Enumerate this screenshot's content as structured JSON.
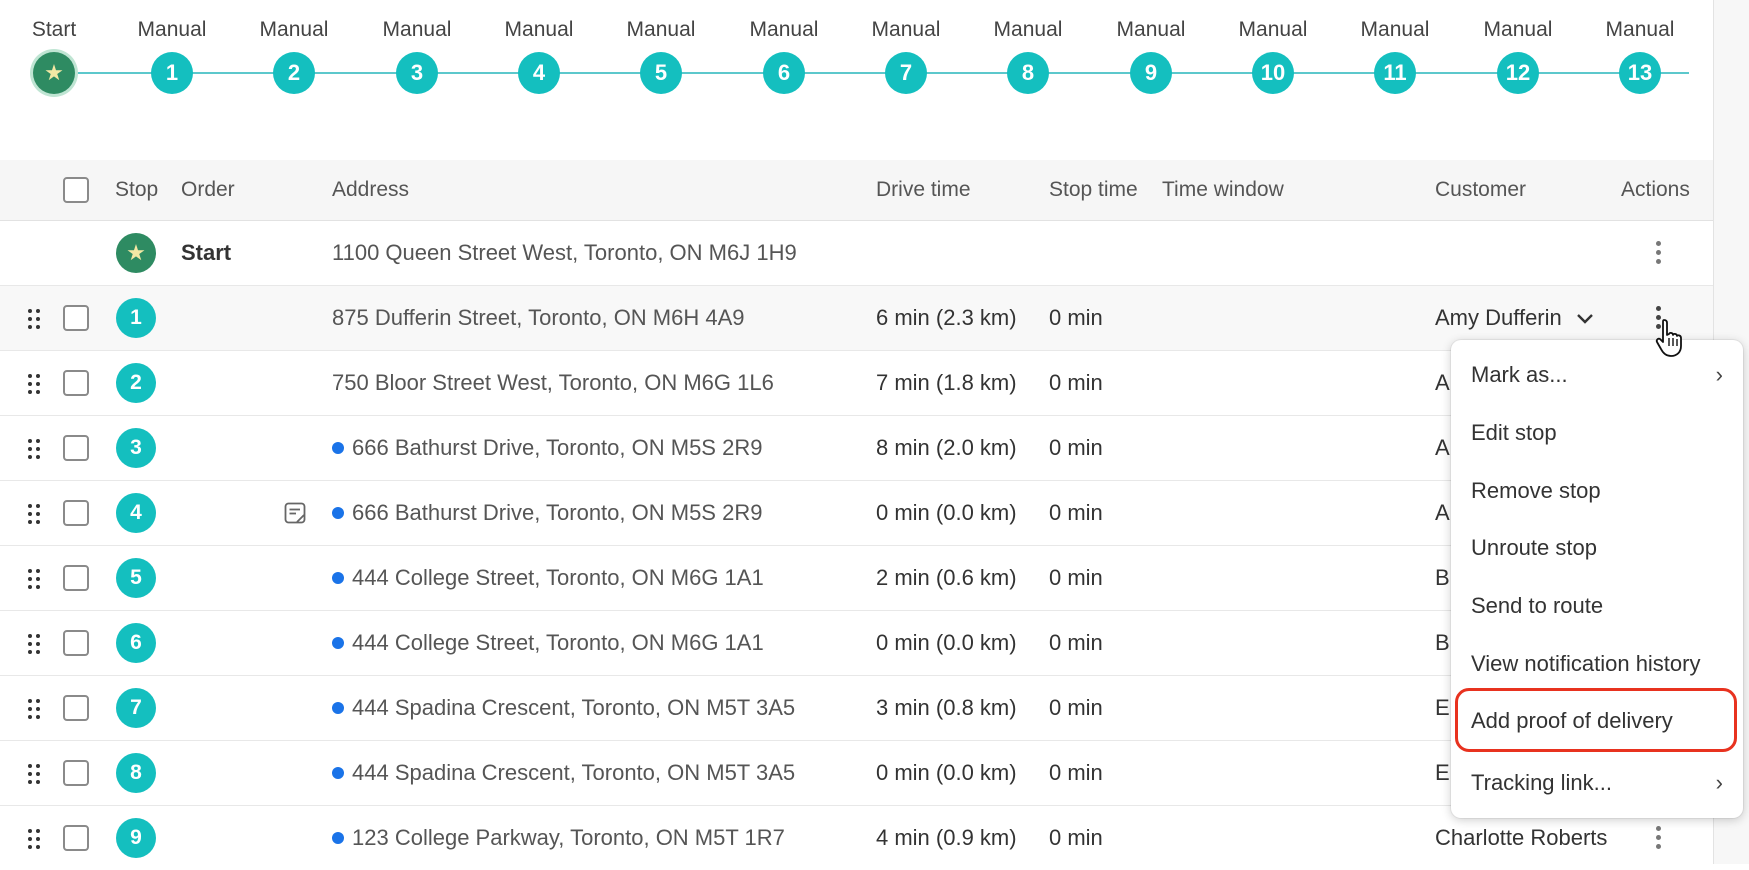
{
  "timeline": {
    "nodes": [
      {
        "label": "Start",
        "badge": "",
        "type": "start"
      },
      {
        "label": "Manual",
        "badge": "1"
      },
      {
        "label": "Manual",
        "badge": "2"
      },
      {
        "label": "Manual",
        "badge": "3"
      },
      {
        "label": "Manual",
        "badge": "4"
      },
      {
        "label": "Manual",
        "badge": "5"
      },
      {
        "label": "Manual",
        "badge": "6"
      },
      {
        "label": "Manual",
        "badge": "7"
      },
      {
        "label": "Manual",
        "badge": "8"
      },
      {
        "label": "Manual",
        "badge": "9"
      },
      {
        "label": "Manual",
        "badge": "10"
      },
      {
        "label": "Manual",
        "badge": "11"
      },
      {
        "label": "Manual",
        "badge": "12"
      },
      {
        "label": "Manual",
        "badge": "13"
      }
    ]
  },
  "table": {
    "headers": {
      "stop": "Stop",
      "order": "Order",
      "address": "Address",
      "drive_time": "Drive time",
      "stop_time": "Stop time",
      "time_window": "Time window",
      "customer": "Customer",
      "actions": "Actions"
    },
    "start_row": {
      "label": "Start",
      "address": "1100 Queen Street West, Toronto, ON M6J 1H9"
    },
    "rows": [
      {
        "stop": "1",
        "address": "875 Dufferin Street, Toronto, ON M6H 4A9",
        "drive": "6 min (2.3 km)",
        "stop_time": "0 min",
        "customer": "Amy Dufferin"
      },
      {
        "stop": "2",
        "address": "750 Bloor Street West, Toronto, ON M6G 1L6",
        "drive": "7 min (1.8 km)",
        "stop_time": "0 min",
        "customer": "A"
      },
      {
        "stop": "3",
        "address": "666 Bathurst Drive, Toronto, ON M5S 2R9",
        "drive": "8 min (2.0 km)",
        "stop_time": "0 min",
        "customer": "A"
      },
      {
        "stop": "4",
        "address": "666 Bathurst Drive, Toronto, ON M5S 2R9",
        "drive": "0 min (0.0 km)",
        "stop_time": "0 min",
        "customer": "A"
      },
      {
        "stop": "5",
        "address": "444 College Street, Toronto, ON M6G 1A1",
        "drive": "2 min (0.6 km)",
        "stop_time": "0 min",
        "customer": "B"
      },
      {
        "stop": "6",
        "address": "444 College Street, Toronto, ON M6G 1A1",
        "drive": "0 min (0.0 km)",
        "stop_time": "0 min",
        "customer": "B"
      },
      {
        "stop": "7",
        "address": "444 Spadina Crescent, Toronto, ON M5T 3A5",
        "drive": "3 min (0.8 km)",
        "stop_time": "0 min",
        "customer": "E"
      },
      {
        "stop": "8",
        "address": "444 Spadina Crescent, Toronto, ON M5T 3A5",
        "drive": "0 min (0.0 km)",
        "stop_time": "0 min",
        "customer": "E"
      },
      {
        "stop": "9",
        "address": "123 College Parkway, Toronto, ON M5T 1R7",
        "drive": "4 min (0.9 km)",
        "stop_time": "0 min",
        "customer": "Charlotte Roberts"
      }
    ]
  },
  "menu": {
    "items": [
      {
        "label": "Mark as...",
        "submenu": true
      },
      {
        "label": "Edit stop"
      },
      {
        "label": "Remove stop"
      },
      {
        "label": "Unroute stop"
      },
      {
        "label": "Send to route"
      },
      {
        "label": "View notification history"
      },
      {
        "label": "Add proof of delivery",
        "highlighted": true
      },
      {
        "label": "Tracking link...",
        "submenu": true
      }
    ]
  },
  "colors": {
    "teal": "#14bfbf",
    "start_green": "#2e8b62",
    "address_dot_blue": "#1a73e8",
    "highlight_red": "#e8321f"
  }
}
